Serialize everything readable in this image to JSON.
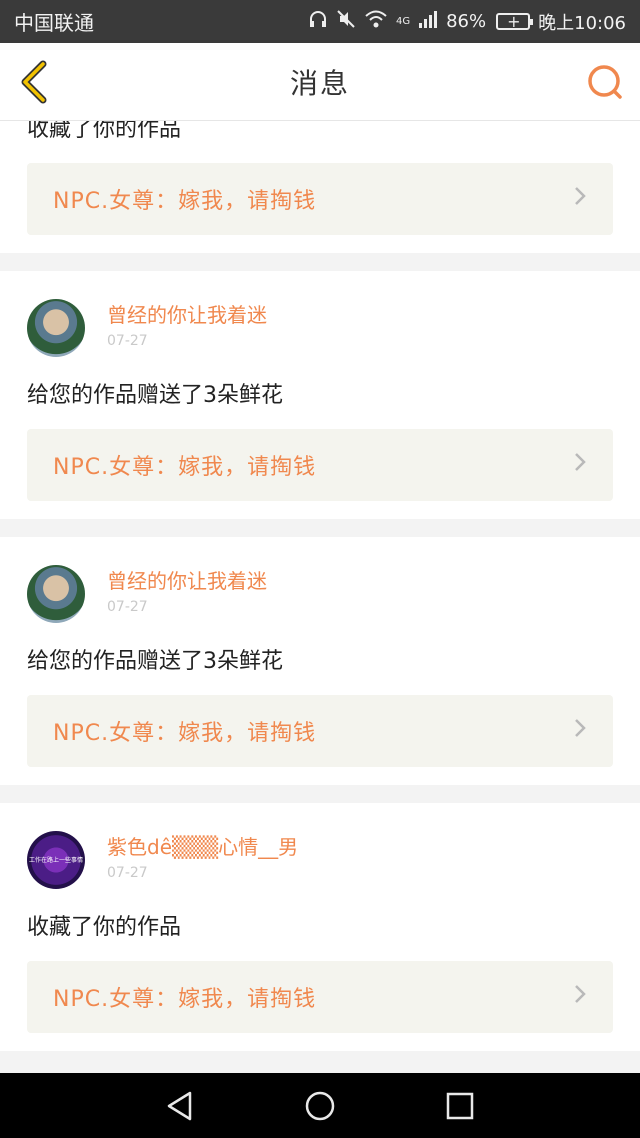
{
  "status_bar": {
    "carrier": "中国联通",
    "battery": "86%",
    "network": "4G",
    "time": "晚上10:06"
  },
  "header": {
    "title": "消息",
    "accent_color": "#f0884e"
  },
  "feed": {
    "first_card": {
      "action": "收藏了你的作品",
      "work_title": "NPC.女尊：嫁我，请掏钱"
    },
    "items": [
      {
        "username": "曾经的你让我着迷",
        "time": "07-27",
        "action": "给您的作品赠送了3朵鲜花",
        "work_title": "NPC.女尊：嫁我，请掏钱"
      },
      {
        "username": "曾经的你让我着迷",
        "time": "07-27",
        "action": "给您的作品赠送了3朵鲜花",
        "work_title": "NPC.女尊：嫁我，请掏钱"
      },
      {
        "username": "紫色dê▒▒▒心情__男",
        "time": "07-27",
        "avatar_text": "工作在路上一些事情",
        "action": "收藏了你的作品",
        "work_title": "NPC.女尊：嫁我，请掏钱"
      }
    ]
  },
  "icons": {
    "back": "back-chevron-icon",
    "search": "search-icon",
    "chevron": "chevron-right-icon",
    "nav_back": "triangle-back-icon",
    "nav_home": "circle-home-icon",
    "nav_recent": "square-recent-icon"
  }
}
